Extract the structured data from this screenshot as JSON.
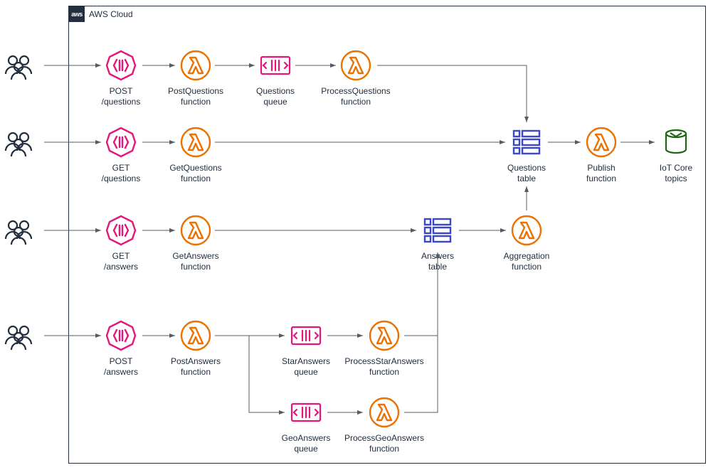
{
  "cloud_label": "AWS Cloud",
  "aws_logo_text": "aws",
  "nodes": {
    "api_post_questions": {
      "l1": "POST",
      "l2": "/questions"
    },
    "api_get_questions": {
      "l1": "GET",
      "l2": "/questions"
    },
    "api_get_answers": {
      "l1": "GET",
      "l2": "/answers"
    },
    "api_post_answers": {
      "l1": "POST",
      "l2": "/answers"
    },
    "fn_post_questions": {
      "l1": "PostQuestions",
      "l2": "function"
    },
    "fn_get_questions": {
      "l1": "GetQuestions",
      "l2": "function"
    },
    "fn_get_answers": {
      "l1": "GetAnswers",
      "l2": "function"
    },
    "fn_post_answers": {
      "l1": "PostAnswers",
      "l2": "function"
    },
    "q_questions": {
      "l1": "Questions",
      "l2": "queue"
    },
    "q_star_answers": {
      "l1": "StarAnswers",
      "l2": "queue"
    },
    "q_geo_answers": {
      "l1": "GeoAnswers",
      "l2": "queue"
    },
    "fn_process_questions": {
      "l1": "ProcessQuestions",
      "l2": "function"
    },
    "fn_process_star_answers": {
      "l1": "ProcessStarAnswers",
      "l2": "function"
    },
    "fn_process_geo_answers": {
      "l1": "ProcessGeoAnswers",
      "l2": "function"
    },
    "tbl_questions": {
      "l1": "Questions",
      "l2": "table"
    },
    "tbl_answers": {
      "l1": "Answers",
      "l2": "table"
    },
    "fn_aggregation": {
      "l1": "Aggregation",
      "l2": "function"
    },
    "fn_publish": {
      "l1": "Publish",
      "l2": "function"
    },
    "iot_core": {
      "l1": "IoT Core",
      "l2": "topics"
    }
  },
  "colors": {
    "api": "#e7157b",
    "lambda": "#ed7100",
    "sqs_fill": "#e7157b",
    "ddb": "#3b48cc",
    "iot": "#1b660f",
    "users": "#232f3e",
    "border": "#232f3e"
  }
}
